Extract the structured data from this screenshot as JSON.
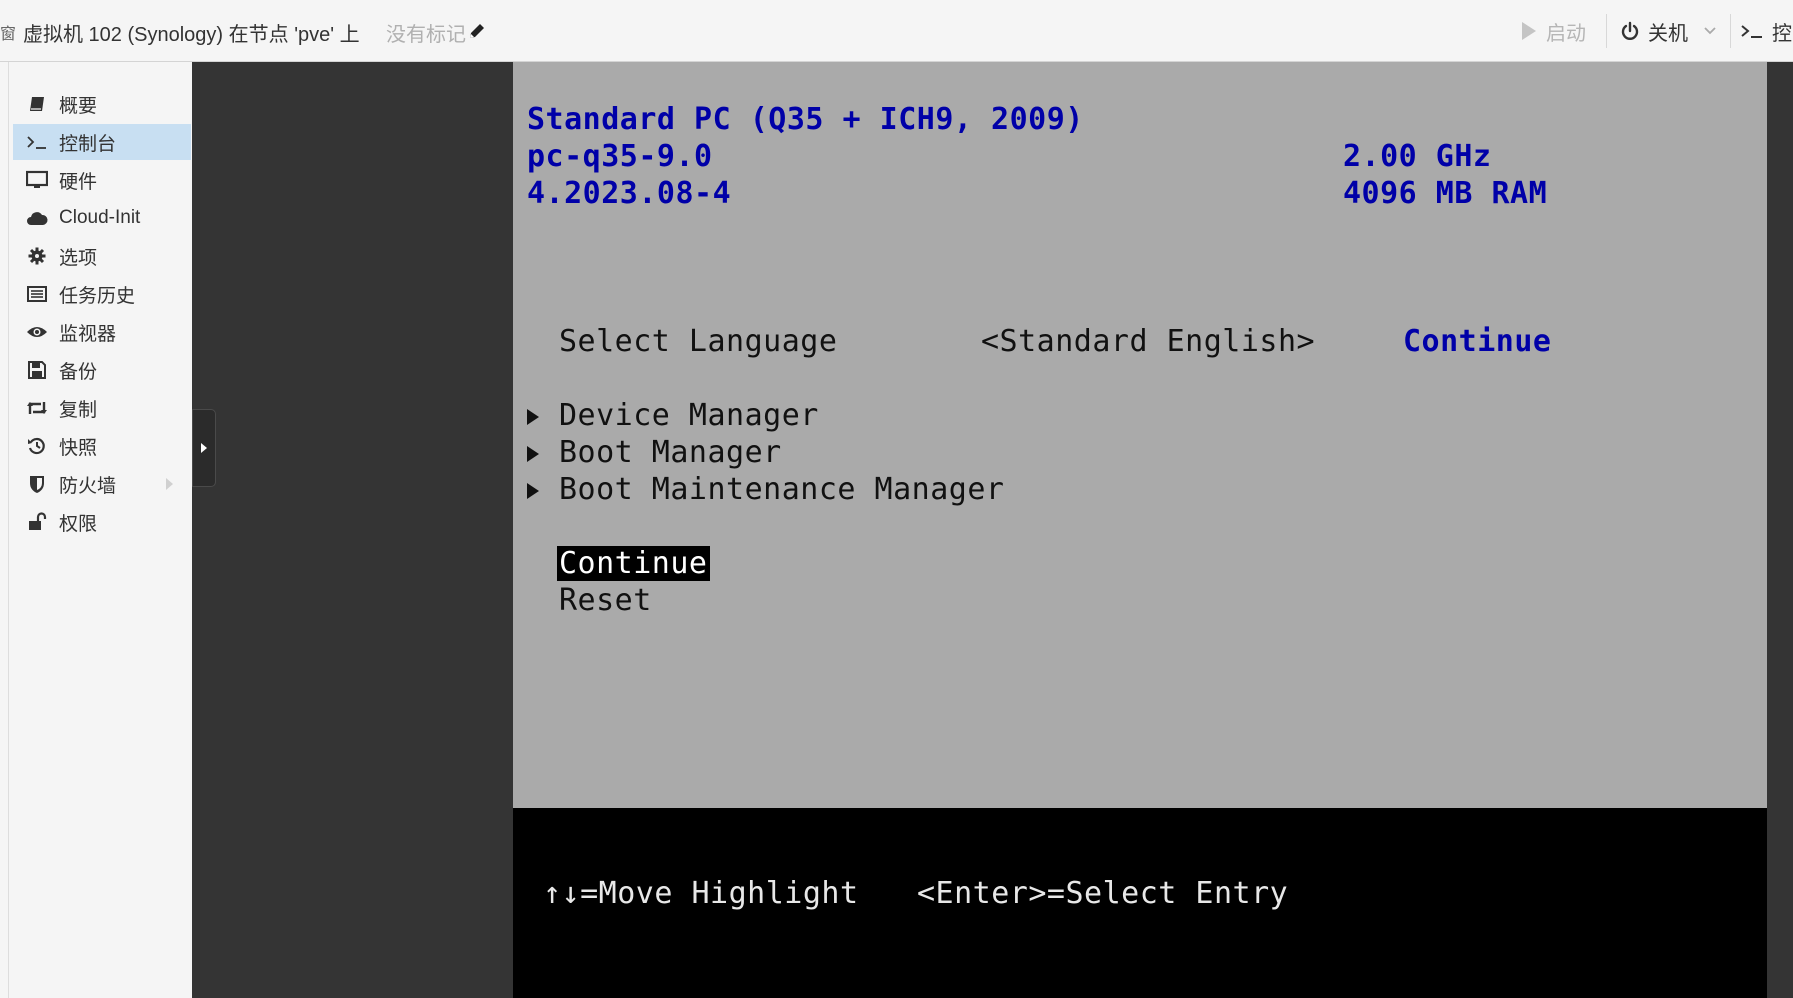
{
  "header": {
    "edge_glyph": "窗",
    "title": "虚拟机 102 (Synology) 在节点 'pve' 上",
    "tags_placeholder": "没有标记",
    "start_label": "启动",
    "shutdown_label": "关机",
    "console_label": "控"
  },
  "sidebar": {
    "items": [
      {
        "label": "概要",
        "icon": "book-icon"
      },
      {
        "label": "控制台",
        "icon": "terminal-icon",
        "active": true
      },
      {
        "label": "硬件",
        "icon": "monitor-icon"
      },
      {
        "label": "Cloud-Init",
        "icon": "cloud-icon"
      },
      {
        "label": "选项",
        "icon": "gear-icon"
      },
      {
        "label": "任务历史",
        "icon": "list-icon"
      },
      {
        "label": "监视器",
        "icon": "eye-icon"
      },
      {
        "label": "备份",
        "icon": "floppy-icon"
      },
      {
        "label": "复制",
        "icon": "retweet-icon"
      },
      {
        "label": "快照",
        "icon": "history-icon"
      },
      {
        "label": "防火墙",
        "icon": "shield-icon",
        "has_submenu": true
      },
      {
        "label": "权限",
        "icon": "unlock-icon"
      }
    ]
  },
  "bios": {
    "machine": "Standard PC (Q35 + ICH9, 2009)",
    "machine_type": "pc-q35-9.0",
    "firmware_version": "4.2023.08-4",
    "cpu_speed": "2.00 GHz",
    "ram": "4096 MB RAM",
    "language_label": "Select Language",
    "language_value": "<Standard English>",
    "help_text": "Continue",
    "menu": [
      "Device Manager",
      "Boot Manager",
      "Boot Maintenance Manager"
    ],
    "actions": [
      "Continue",
      "Reset"
    ],
    "selected_action": "Continue",
    "footer_move": "↑↓=Move Highlight",
    "footer_select": "<Enter>=Select Entry"
  },
  "colors": {
    "bios_bg": "#aaaaaa",
    "bios_blue": "#0000a8",
    "active_nav": "#c8dff2",
    "console_bg": "#343434"
  }
}
